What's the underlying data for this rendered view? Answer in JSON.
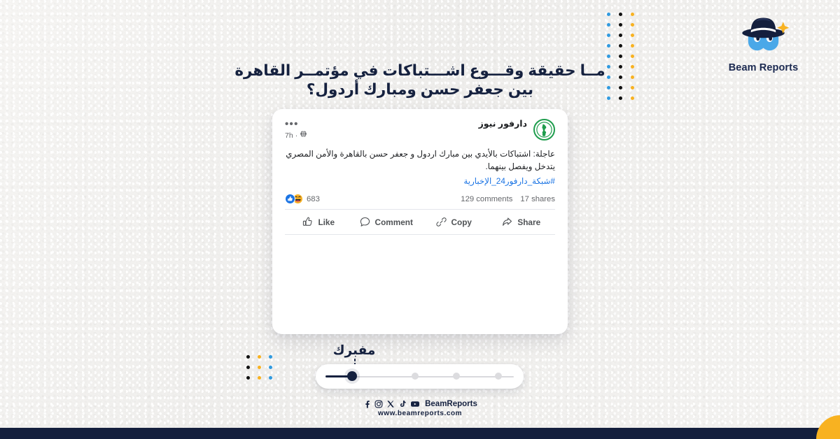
{
  "brand": {
    "name": "Beam Reports",
    "logo_icon": "detective-hat-face-icon",
    "colors": {
      "navy": "#15213f",
      "hat": "#141f3d",
      "face_blue": "#4aa8e8",
      "star_yellow": "#f8b221",
      "accent_orange": "#f8b221",
      "accent_blue": "#2f9ae0",
      "accent_black": "#101010"
    }
  },
  "headline": {
    "line1": "مــا حقيقة وقـــوع اشـــتباكات في مؤتمــر القاهرة",
    "line2": "بين جعفر حسن ومبارك أردول؟"
  },
  "dot_grid_right": {
    "rows": 9,
    "columns": 3,
    "column_colors": [
      "#f8b221",
      "#101010",
      "#2f9ae0"
    ]
  },
  "dot_grid_left": {
    "rows": 3,
    "columns": 3,
    "column_colors": [
      "#2f9ae0",
      "#f8b221",
      "#101010"
    ]
  },
  "post": {
    "author": "دارفور نيوز",
    "avatar_icon": "darfur-news-green-logo-icon",
    "time": "7h",
    "separator": "·",
    "audience_icon": "globe-icon",
    "more_icon": "ellipsis-icon",
    "more_label": "•••",
    "body": "عاجلة: اشتباكات بالأيدي بين مبارك اردول و جعفر حسن بالقاهرة والأمن المصري يتدخل ويفصل بينهما.",
    "hashtag": "#شبكة_دارفور24_الإخبارية",
    "reactions": {
      "like_icon": "thumbs-up-reaction-icon",
      "haha_icon": "haha-reaction-icon",
      "count": "683"
    },
    "comments": "129 comments",
    "shares": "17 shares",
    "actions": [
      {
        "label": "Like",
        "icon": "thumbs-up-icon"
      },
      {
        "label": "Comment",
        "icon": "comment-bubble-icon"
      },
      {
        "label": "Copy",
        "icon": "link-chain-icon"
      },
      {
        "label": "Share",
        "icon": "share-arrow-icon"
      }
    ]
  },
  "verdict": {
    "label": "مفبرك",
    "pointer_icon": "pointer-down-icon",
    "active_step": 1,
    "total_steps": 4,
    "fill_color": "#15213f",
    "track_color": "#d9d9dd"
  },
  "footer": {
    "socials": [
      {
        "name": "facebook-icon"
      },
      {
        "name": "instagram-icon"
      },
      {
        "name": "x-twitter-icon"
      },
      {
        "name": "tiktok-icon"
      },
      {
        "name": "youtube-icon"
      }
    ],
    "handle": "BeamReports",
    "url": "www.beamreports.com"
  }
}
